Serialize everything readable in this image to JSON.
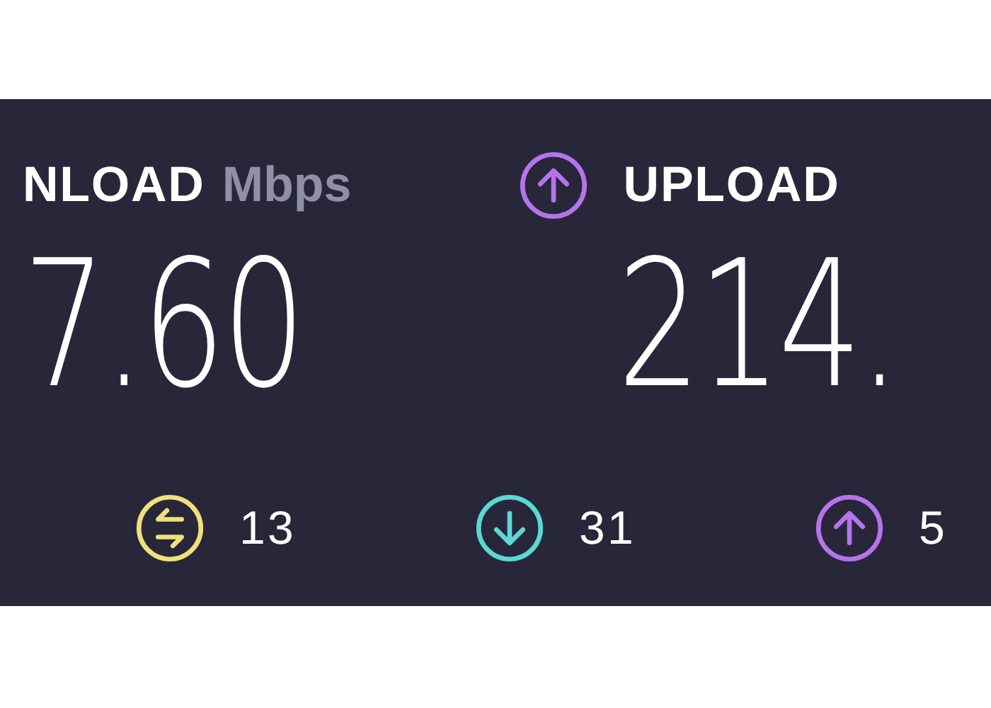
{
  "download": {
    "label": "NLOAD",
    "unit": "Mbps",
    "value": "7.60"
  },
  "upload": {
    "label": "UPLOAD",
    "value": "214."
  },
  "stats": [
    {
      "kind": "ping",
      "value": "13"
    },
    {
      "kind": "down",
      "value": "31"
    },
    {
      "kind": "up",
      "value": "5"
    }
  ]
}
